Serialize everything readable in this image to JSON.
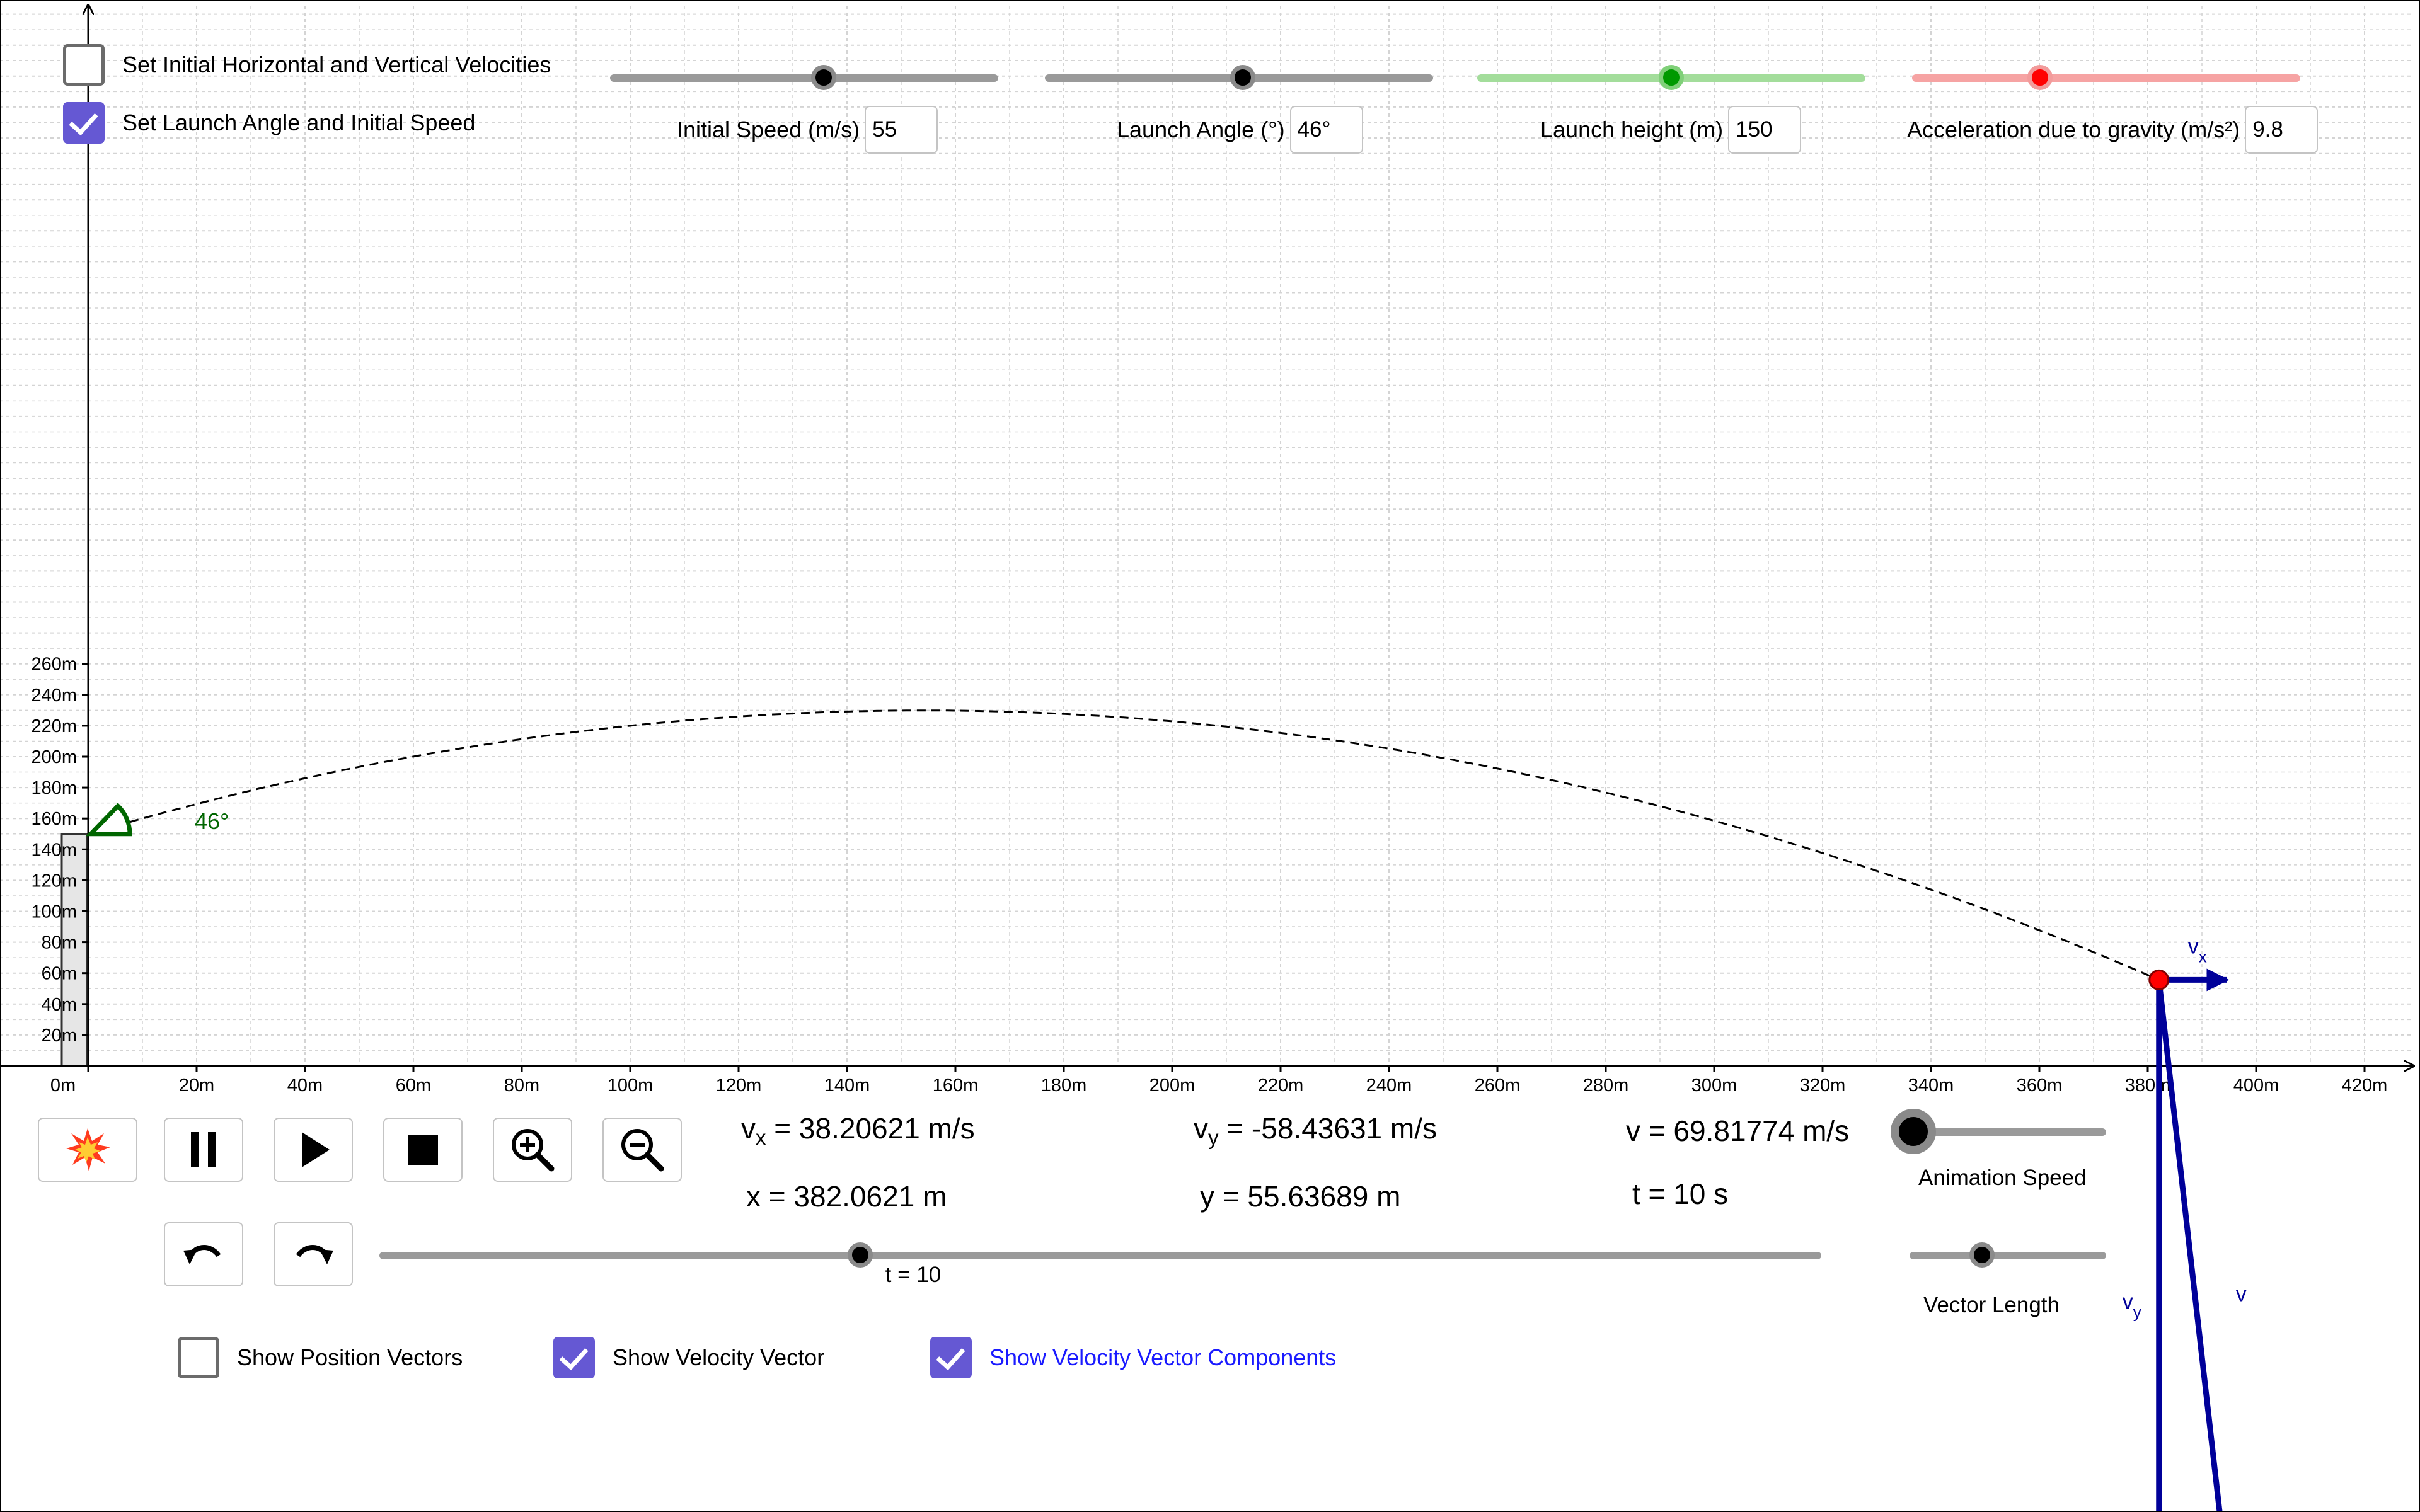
{
  "controls": {
    "set_components_label": "Set Initial Horizontal and Vertical Velocities",
    "set_components_checked": false,
    "set_angle_label": "Set Launch Angle and Initial Speed",
    "set_angle_checked": true
  },
  "parameters": {
    "initial_speed": {
      "label": "Initial Speed (m/s)",
      "value": "55",
      "level": 0.55
    },
    "launch_angle": {
      "label": "Launch Angle (°)",
      "value": "46°",
      "level": 0.51
    },
    "launch_height": {
      "label": "Launch height (m)",
      "value": "150",
      "level": 0.5
    },
    "gravity": {
      "label": "Acceleration due to gravity (m/s²)",
      "value": "9.8",
      "level": 0.33
    }
  },
  "graph": {
    "x_ticks": [
      "0m",
      "20m",
      "40m",
      "60m",
      "80m",
      "100m",
      "120m",
      "140m",
      "160m",
      "180m",
      "200m",
      "220m",
      "240m",
      "260m",
      "280m",
      "300m",
      "320m",
      "340m",
      "360m",
      "380m",
      "400m",
      "420m"
    ],
    "y_ticks": [
      "20m",
      "40m",
      "60m",
      "80m",
      "100m",
      "120m",
      "140m",
      "160m",
      "180m",
      "200m",
      "220m",
      "240m",
      "260m"
    ],
    "angle_label": "46°",
    "vx_label": "v",
    "vx_sub": "x",
    "vy_label": "v",
    "vy_sub": "y",
    "v_label": "v",
    "launch_speed": 55,
    "launch_angle_deg": 46,
    "launch_height": 150,
    "gravity": 9.8,
    "time": 10,
    "colors": {
      "vector": "#000099",
      "angle": "#006600",
      "ball": "#ff0000",
      "tower": "#e6e6e6"
    }
  },
  "toolbar": {
    "buttons": [
      "explosion-icon",
      "pause-icon",
      "play-icon",
      "stop-icon",
      "zoom-in-icon",
      "zoom-out-icon",
      "undo-icon",
      "redo-icon"
    ]
  },
  "readouts": {
    "vx_symbol": "v",
    "vx_sub": "x",
    "vx_value": " = 38.20621 m/s",
    "vy_symbol": "v",
    "vy_sub": "y",
    "vy_value": " = -58.43631 m/s",
    "v_text": "v = 69.81774 m/s",
    "x_text": "x = 382.0621 m",
    "y_text": "y = 55.63689 m",
    "t_text": "t = 10 s"
  },
  "time_slider": {
    "label": "t = 10",
    "value": 10,
    "min": 0,
    "max": 30
  },
  "animation_speed": {
    "label": "Animation Speed",
    "level": 0.0
  },
  "vector_length": {
    "label": "Vector Length",
    "level": 0.37
  },
  "display_options": {
    "position_vectors_label": "Show Position Vectors",
    "position_vectors_checked": false,
    "velocity_vector_label": "Show Velocity Vector",
    "velocity_vector_checked": true,
    "velocity_components_label": "Show Velocity Vector Components",
    "velocity_components_checked": true
  }
}
